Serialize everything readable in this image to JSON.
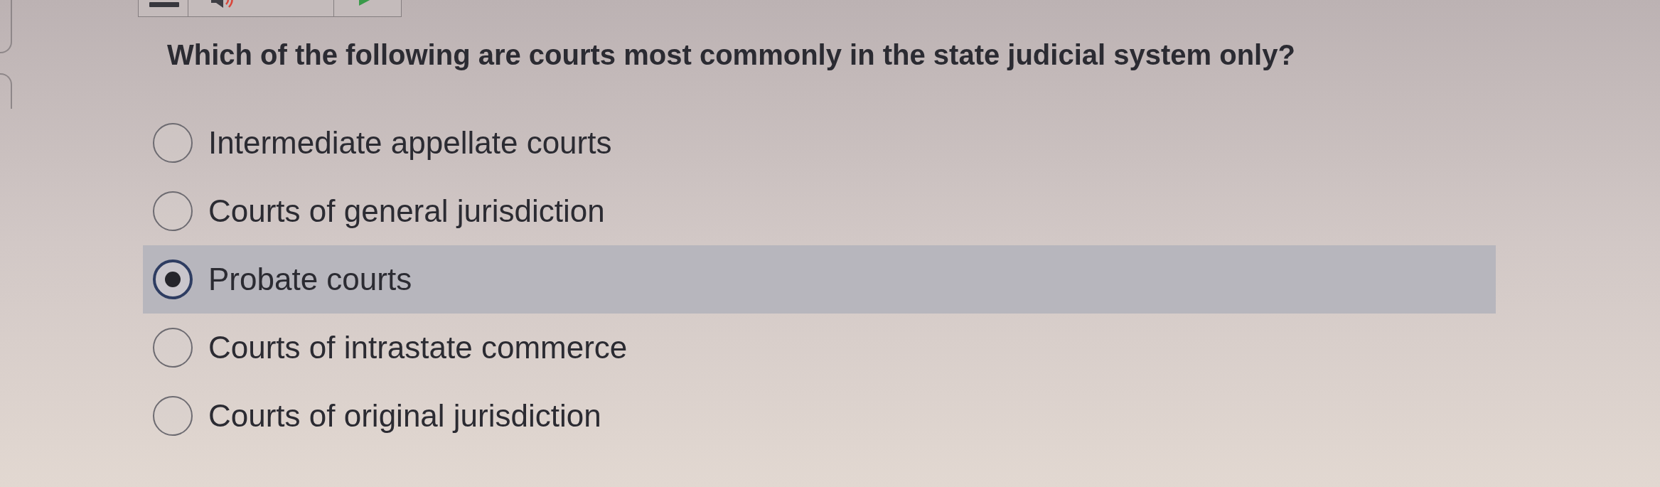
{
  "toolbar": [
    {
      "kind": "menu"
    },
    {
      "kind": "listen"
    },
    {
      "kind": "play"
    }
  ],
  "question": "Which of the following are courts most commonly in the state judicial system only?",
  "options": [
    {
      "label": "Intermediate appellate courts",
      "selected": false
    },
    {
      "label": "Courts of general jurisdiction",
      "selected": false
    },
    {
      "label": "Probate courts",
      "selected": true
    },
    {
      "label": "Courts of intrastate commerce",
      "selected": false
    },
    {
      "label": "Courts of original jurisdiction",
      "selected": false
    }
  ]
}
